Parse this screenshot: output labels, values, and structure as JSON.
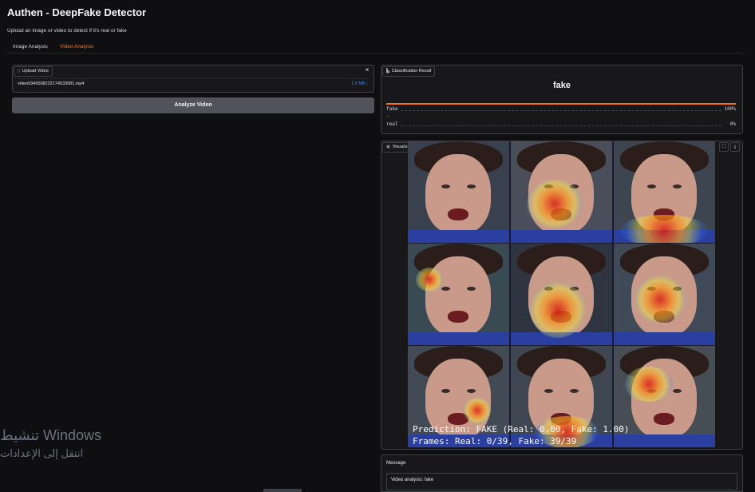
{
  "app": {
    "title": "Authen - DeepFake Detector",
    "subtitle": "Upload an image or video to detect if it's real or fake"
  },
  "tabs": [
    {
      "label": "Image Analysis",
      "active": false
    },
    {
      "label": "Video Analysis",
      "active": true
    }
  ],
  "upload": {
    "label": "Upload Video",
    "icon": "file-icon",
    "file_name": "video5940508222174533081.mp4",
    "file_size": "1.9 MB ↓",
    "close_icon": "×"
  },
  "analyze_button": "Analyze Video",
  "classification": {
    "label": "Classification Result",
    "icon": "label-icon",
    "result": "fake",
    "rows": [
      {
        "name": "fake",
        "value": "100%",
        "confidence": 1.0
      },
      {
        "name": "real",
        "value": "0%",
        "confidence": 0.0
      }
    ],
    "dot": "."
  },
  "visualization": {
    "label": "Visualization",
    "icon": "image-icon",
    "fullscreen_icon": "⛶",
    "download_icon": "⤓",
    "prediction_line1": "Prediction: FAKE (Real: 0.00, Fake: 1.00)",
    "prediction_line2": "Frames: Real: 0/39, Fake: 39/39"
  },
  "message": {
    "label": "Message",
    "text": "Video analysis: fake"
  },
  "watermark": {
    "line1": "تنشيط Windows",
    "line2": "انتقل إلى الإعدادات"
  },
  "colors": {
    "accent": "#f97316",
    "background": "#0f0f11",
    "panel": "#18181b",
    "link": "#3b82f6"
  }
}
